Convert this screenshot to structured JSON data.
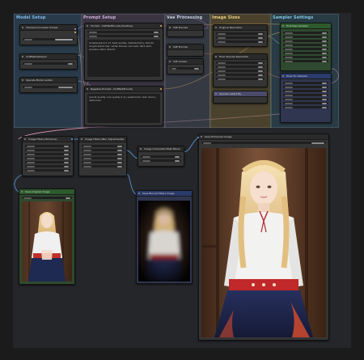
{
  "groups": [
    {
      "title": "Model Setup",
      "color": "#2e4c66",
      "title_color": "#7fb8e8"
    },
    {
      "title": "Prompt Setup",
      "color": "#4a3d52",
      "title_color": "#d0b0e0"
    },
    {
      "title": "Vae Processing",
      "color": "#3d4450",
      "title_color": "#c8d0dc"
    },
    {
      "title": "Image Sizes",
      "color": "#5e5230",
      "title_color": "#e8d080"
    },
    {
      "title": "Sampler Settings",
      "color": "#2e4c5a",
      "title_color": "#80c8e0"
    }
  ],
  "nodes": {
    "checkpoint": "Checkpoint Loader Simple",
    "clip_set": "CLIPSetLastLayer",
    "lora": "Upscale Model Loader",
    "pos_prompt": "Prompt - CLIPTextEncode (Positive)",
    "neg_prompt": "Negative Prompt - CLIPTextEncode",
    "vae_decode": "VAE Decode",
    "vae_encode": "VAE Encode",
    "vae_loader": "VAE Loader",
    "orig_res": "Original Resolution",
    "upscale_res": "Final Upscale Resolution",
    "upscale_latent": "Upscale Latent By",
    "first_sampler": "First Pass Sampler",
    "hires_sampler": "Hires Fix Sampler",
    "img_filters_1": "Image Filters (Enhance)",
    "img_filters_2": "Image Filters (Blur Adjustments)",
    "img_blend": "Image Composite Mask Blend",
    "save_orig": "Save Original Image",
    "save_blur": "Save Blurred Filters Image",
    "save_enhanced": "Save Enhanced Image",
    "filename_prefix": "ComfyUI"
  },
  "prompts": {
    "positive": "(masterpiece:1.2), best quality, detailed face, blonde long braided hair, white blouse, red vest, dark skirt, wooden cabin interior",
    "negative": "(worst quality, low quality:1.4), watermark, text, blurry, deformed"
  }
}
